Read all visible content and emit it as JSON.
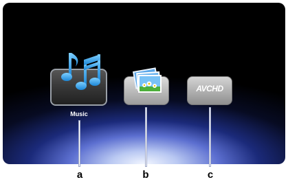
{
  "menu": {
    "items": [
      {
        "id": "music",
        "label": "Music",
        "icon": "music-notes-icon"
      },
      {
        "id": "photo",
        "label": "",
        "icon": "photo-folder-icon"
      },
      {
        "id": "video",
        "label": "",
        "icon": "avchd-logo-icon",
        "logo_text": "AVCHD"
      }
    ]
  },
  "callouts": [
    "a",
    "b",
    "c"
  ],
  "colors": {
    "note_blue": "#2aa8e8",
    "screen_dark": "#000000",
    "glow": "#b9c8f2"
  }
}
